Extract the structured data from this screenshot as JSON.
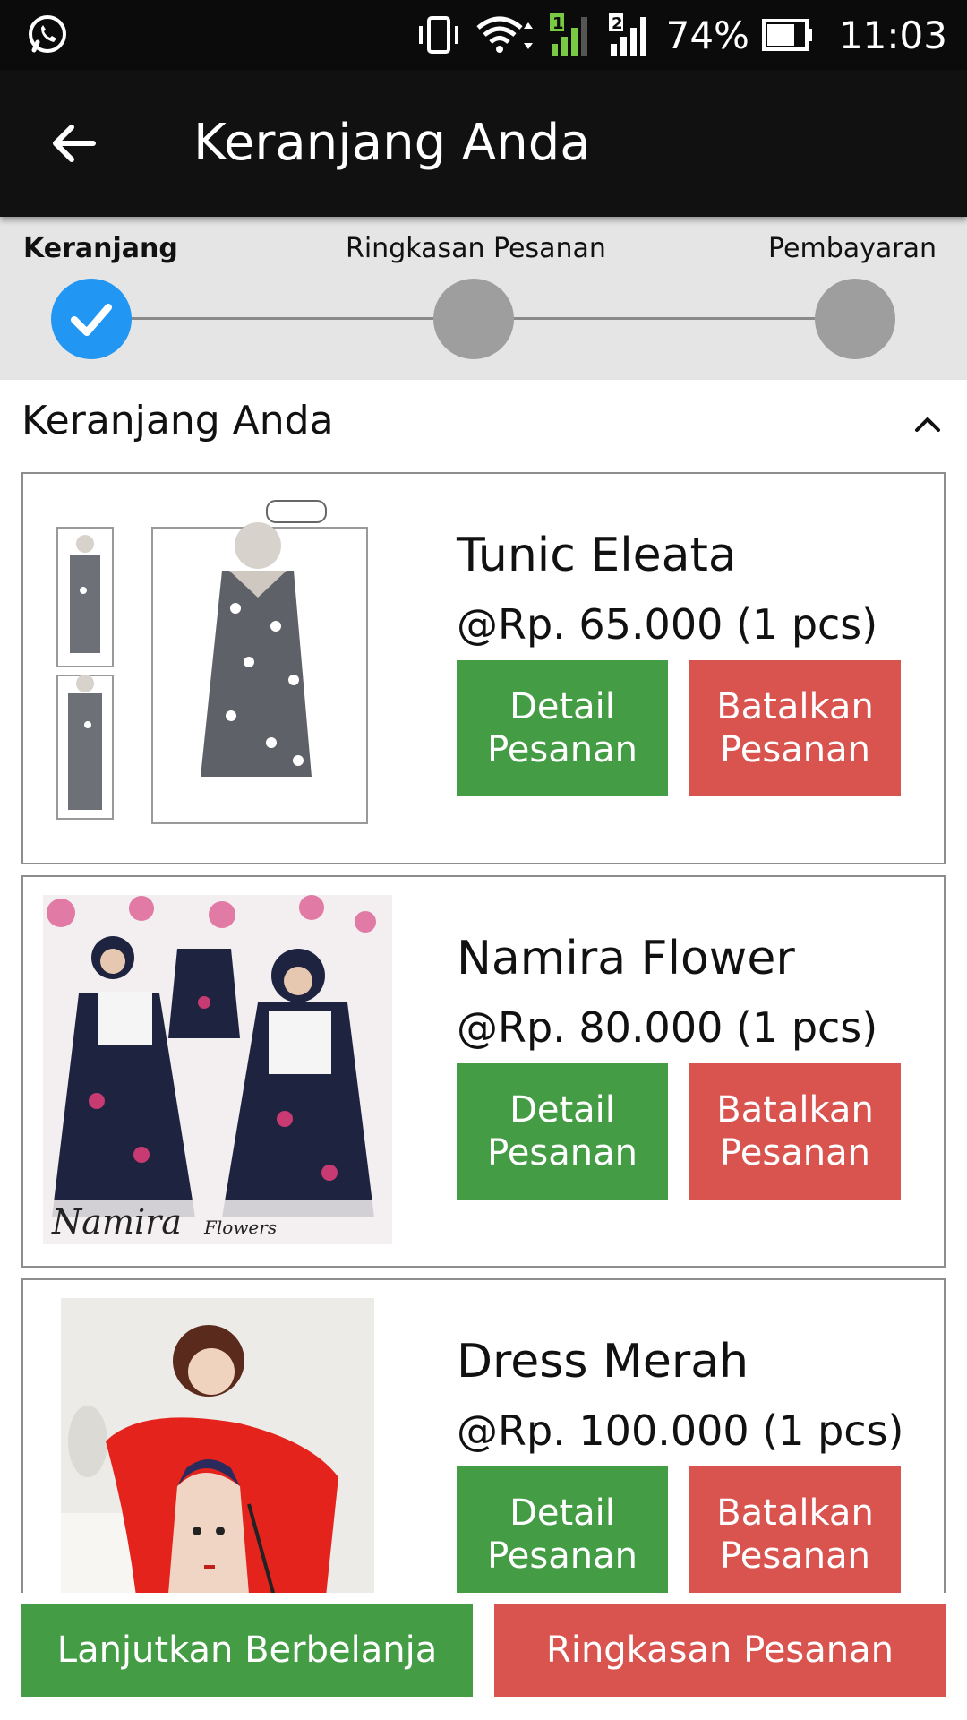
{
  "status_bar": {
    "battery": "74%",
    "time": "11:03",
    "icons": [
      "whatsapp-icon",
      "vibrate-icon",
      "wifi-icon",
      "signal-sim1-icon",
      "signal-sim2-icon",
      "battery-icon"
    ]
  },
  "app_bar": {
    "title": "Keranjang Anda",
    "back_icon": "arrow-back-icon"
  },
  "stepper": {
    "steps": [
      {
        "label": "Keranjang",
        "state": "done"
      },
      {
        "label": "Ringkasan Pesanan",
        "state": "pending"
      },
      {
        "label": "Pembayaran",
        "state": "pending"
      }
    ]
  },
  "section": {
    "title": "Keranjang Anda",
    "toggle_icon": "chevron-up-icon"
  },
  "items": [
    {
      "name": "Tunic Eleata",
      "price": "@Rp. 65.000 (1 pcs)",
      "detail_line1": "Detail",
      "detail_line2": "Pesanan",
      "cancel_line1": "Batalkan",
      "cancel_line2": "Pesanan"
    },
    {
      "name": "Namira Flower",
      "price": "@Rp. 80.000 (1 pcs)",
      "detail_line1": "Detail",
      "detail_line2": "Pesanan",
      "cancel_line1": "Batalkan",
      "cancel_line2": "Pesanan"
    },
    {
      "name": "Dress Merah",
      "price": "@Rp. 100.000 (1 pcs)",
      "detail_line1": "Detail",
      "detail_line2": "Pesanan",
      "cancel_line1": "Batalkan",
      "cancel_line2": "Pesanan"
    }
  ],
  "bottom": {
    "continue_label": "Lanjutkan Berbelanja",
    "summary_label": "Ringkasan Pesanan"
  },
  "colors": {
    "green": "#449d45",
    "red": "#d9534f",
    "step_active": "#2196f3",
    "step_inactive": "#9e9e9e"
  }
}
